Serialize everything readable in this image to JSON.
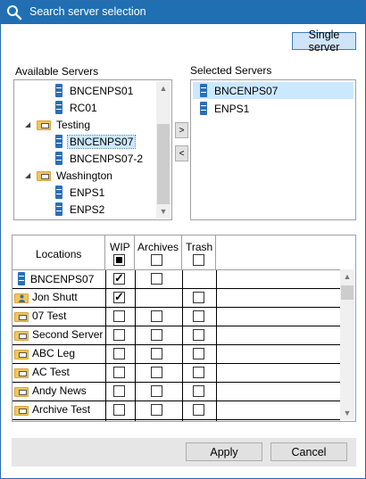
{
  "window": {
    "title": "Search server selection",
    "icon": "search-icon"
  },
  "single_server_label": "Single server",
  "available": {
    "label": "Available Servers",
    "items": [
      {
        "type": "server",
        "label": "BNCENPS01",
        "level": 2
      },
      {
        "type": "server",
        "label": "RC01",
        "level": 2
      },
      {
        "type": "folder",
        "label": "Testing",
        "level": 1,
        "expanded": true
      },
      {
        "type": "server",
        "label": "BNCENPS07",
        "level": 2,
        "selected": true
      },
      {
        "type": "server",
        "label": "BNCENPS07-2",
        "level": 2
      },
      {
        "type": "folder",
        "label": "Washington",
        "level": 1,
        "expanded": true
      },
      {
        "type": "server",
        "label": "ENPS1",
        "level": 2
      },
      {
        "type": "server",
        "label": "ENPS2",
        "level": 2
      }
    ]
  },
  "move_right_label": ">",
  "move_left_label": "<",
  "selected": {
    "label": "Selected Servers",
    "items": [
      {
        "label": "BNCENPS07",
        "selected": true
      },
      {
        "label": "ENPS1"
      }
    ]
  },
  "locations": {
    "headers": {
      "locations": "Locations",
      "wip": "WIP",
      "archives": "Archives",
      "trash": "Trash"
    },
    "header_checks": {
      "wip": "indeterminate",
      "archives": "unchecked",
      "trash": "unchecked"
    },
    "rows": [
      {
        "name": "BNCENPS07",
        "icon": "server-icon",
        "wip": true,
        "archives": false,
        "trash": null
      },
      {
        "name": "Jon Shutt",
        "icon": "user-folder-icon",
        "wip": true,
        "archives": null,
        "trash": false
      },
      {
        "name": "07 Test",
        "icon": "monitor-folder-icon",
        "wip": false,
        "archives": false,
        "trash": false
      },
      {
        "name": "Second Server",
        "icon": "monitor-folder-icon",
        "wip": false,
        "archives": false,
        "trash": false
      },
      {
        "name": "ABC Leg",
        "icon": "monitor-folder-icon",
        "wip": false,
        "archives": false,
        "trash": false
      },
      {
        "name": "AC Test",
        "icon": "monitor-folder-icon",
        "wip": false,
        "archives": false,
        "trash": false
      },
      {
        "name": "Andy News",
        "icon": "monitor-folder-icon",
        "wip": false,
        "archives": false,
        "trash": false
      },
      {
        "name": "Archive Test",
        "icon": "monitor-folder-icon",
        "wip": false,
        "archives": false,
        "trash": false
      }
    ]
  },
  "apply_label": "Apply",
  "cancel_label": "Cancel"
}
